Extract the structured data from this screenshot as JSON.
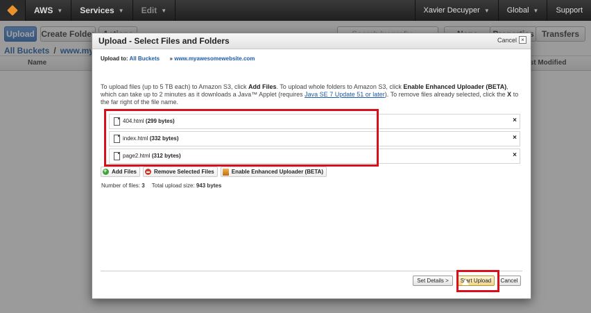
{
  "nav": {
    "brand": "AWS",
    "services": "Services",
    "edit": "Edit",
    "user": "Xavier Decuyper",
    "region": "Global",
    "support": "Support"
  },
  "console": {
    "upload_button": "Upload",
    "create_folder_button": "Create Folder",
    "actions_button": "Actions",
    "search_placeholder": "Search by prefix",
    "none_button": "None",
    "properties_button": "Properties",
    "transfers_button": "Transfers",
    "breadcrumb": {
      "root": "All Buckets",
      "bucket": "www.myawesomewebsite.com"
    },
    "columns": {
      "name": "Name",
      "last_modified": "Last Modified"
    }
  },
  "modal": {
    "title": "Upload - Select Files and Folders",
    "cancel_label": "Cancel",
    "upload_to_label": "Upload to:",
    "upload_to_root": "All Buckets",
    "upload_to_bucket": "www.myawesomewebsite.com",
    "instructions": {
      "p1": "To upload files (up to 5 TB each) to Amazon S3, click ",
      "add_files": "Add Files",
      "p2": ". To upload whole folders to Amazon S3, click ",
      "enhanced": "Enable Enhanced Uploader (BETA)",
      "p3": ", which can take up to 2 minutes as it downloads a Java™ Applet (requires ",
      "java_link": "Java SE 7 Update 51 or later",
      "p4": "). To remove files already selected, click the ",
      "x_label": "X",
      "p5": " to the far right of the file name."
    },
    "files": [
      {
        "name": "404.html",
        "size": "(299 bytes)"
      },
      {
        "name": "index.html",
        "size": "(332 bytes)"
      },
      {
        "name": "page2.html",
        "size": "(312 bytes)"
      }
    ],
    "remove_glyph": "×",
    "actions": {
      "add_files": "Add Files",
      "remove_selected": "Remove Selected Files",
      "enhanced_uploader": "Enable Enhanced Uploader (BETA)"
    },
    "summary": {
      "count_label": "Number of files:",
      "count": "3",
      "size_label": "Total upload size:",
      "size": "943 bytes"
    },
    "footer": {
      "set_details": "Set Details >",
      "start_upload": "Start Upload",
      "cancel": "Cancel"
    }
  },
  "colors": {
    "highlight": "#d8101c",
    "link": "#1d5aa8",
    "aws_orange": "#e8912d"
  }
}
